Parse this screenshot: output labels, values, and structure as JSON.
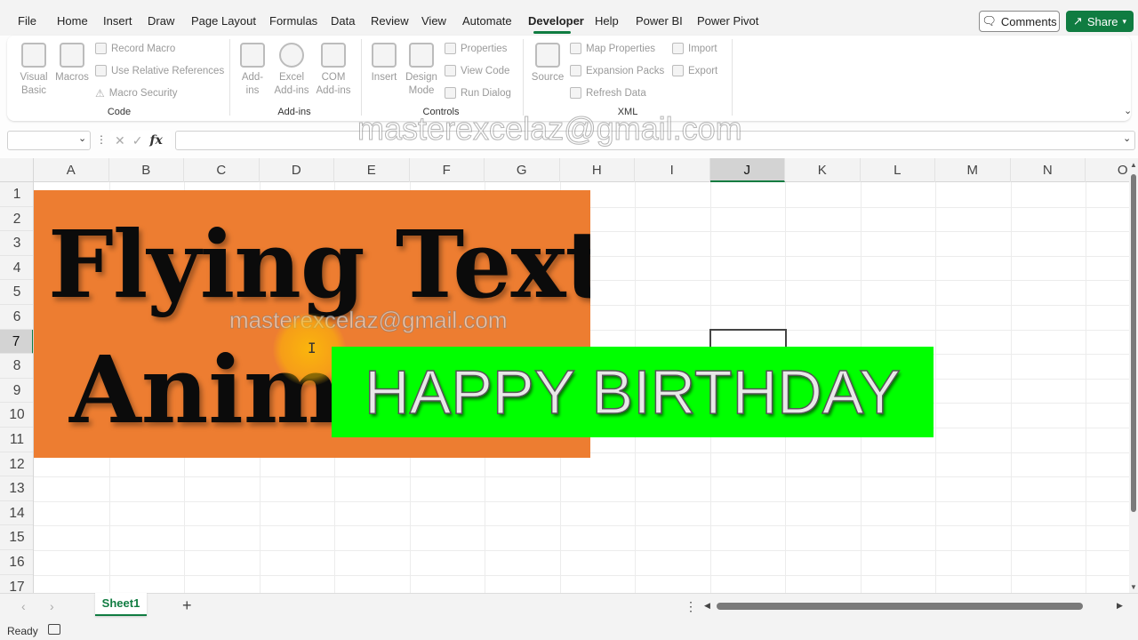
{
  "menu": {
    "tabs": [
      "File",
      "Home",
      "Insert",
      "Draw",
      "Page Layout",
      "Formulas",
      "Data",
      "Review",
      "View",
      "Automate",
      "Developer",
      "Help",
      "Power BI",
      "Power Pivot"
    ],
    "active_tab": "Developer",
    "comments_label": "Comments",
    "share_label": "Share"
  },
  "ribbon": {
    "code": {
      "label": "Code",
      "visual_basic": "Visual Basic",
      "macros": "Macros",
      "record_macro": "Record Macro",
      "use_relative": "Use Relative References",
      "macro_security": "Macro Security"
    },
    "addins": {
      "label": "Add-ins",
      "addins": "Add-ins",
      "excel_addins": "Excel Add-ins",
      "com_addins": "COM Add-ins"
    },
    "controls": {
      "label": "Controls",
      "insert": "Insert",
      "design_mode": "Design Mode",
      "properties": "Properties",
      "view_code": "View Code",
      "run_dialog": "Run Dialog"
    },
    "xml": {
      "label": "XML",
      "source": "Source",
      "map_properties": "Map Properties",
      "expansion_packs": "Expansion Packs",
      "refresh_data": "Refresh Data",
      "import": "Import",
      "export": "Export"
    }
  },
  "formula_bar": {
    "name_box": "",
    "fx_label": "fx",
    "formula": ""
  },
  "grid": {
    "columns": [
      "A",
      "B",
      "C",
      "D",
      "E",
      "F",
      "G",
      "H",
      "I",
      "J",
      "K",
      "L",
      "M",
      "N",
      "O"
    ],
    "rows": [
      "1",
      "2",
      "3",
      "4",
      "5",
      "6",
      "7",
      "8",
      "9",
      "10",
      "11",
      "12",
      "13",
      "14",
      "15",
      "16",
      "17"
    ],
    "selected_column": "J",
    "selected_row": "7"
  },
  "shapes": {
    "title_line1": "Flying Text",
    "title_line2": "Anima",
    "birthday": "HAPPY BIRTHDAY",
    "orange_color": "#ed7d31",
    "green_color": "#00ff00"
  },
  "watermark": "masterexcelaz@gmail.com",
  "sheets": {
    "active": "Sheet1",
    "add_label": "+"
  },
  "status": {
    "ready": "Ready"
  },
  "colors": {
    "accent": "#107c41"
  }
}
